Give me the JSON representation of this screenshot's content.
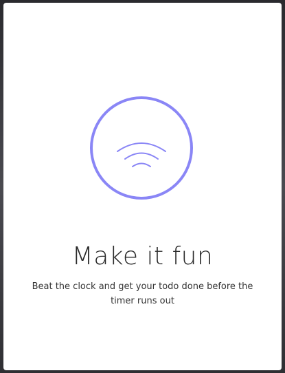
{
  "onboarding": {
    "title": "Make it fun",
    "subtitle": "Beat the clock and get your todo done before the timer runs out",
    "icon": "wifi-signal-icon",
    "accent_color": "#8a86f6"
  }
}
